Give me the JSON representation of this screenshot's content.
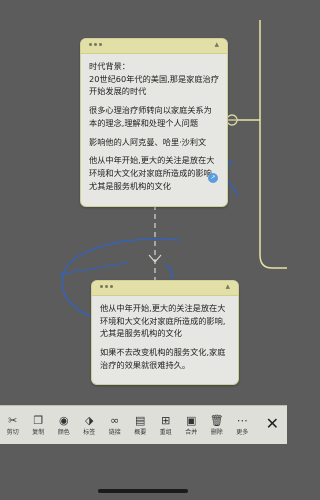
{
  "card_top": {
    "paragraphs": [
      "时代背景：\n20世纪60年代的美国,那是家庭治疗开始发展的时代",
      "很多心理治疗师转向以家庭关系为本的理念,理解和处理个人问题",
      "影响他的人阿克曼、哈里·沙利文",
      "他从中年开始,更大的关注是放在大环境和大文化对家庭所造成的影响,尤其是服务机构的文化"
    ]
  },
  "card_bottom": {
    "paragraphs": [
      "他从中年开始,更大的关注是放在大环境和大文化对家庭所造成的影响,尤其是服务机构的文化",
      "如果不去改变机构的服务文化,家庭治疗的效果就很难持久。"
    ]
  },
  "toolbar": {
    "items": [
      {
        "icon": "scissors-icon",
        "glyph": "✂",
        "label": "剪切"
      },
      {
        "icon": "copy-icon",
        "glyph": "❐",
        "label": "复制"
      },
      {
        "icon": "palette-icon",
        "glyph": "◉",
        "label": "颜色"
      },
      {
        "icon": "tag-icon",
        "glyph": "⬗",
        "label": "标签"
      },
      {
        "icon": "link-icon",
        "glyph": "∞",
        "label": "链接"
      },
      {
        "icon": "summary-icon",
        "glyph": "▤",
        "label": "概要"
      },
      {
        "icon": "layout-icon",
        "glyph": "⊞",
        "label": "重组"
      },
      {
        "icon": "merge-icon",
        "glyph": "▣",
        "label": "合并"
      },
      {
        "icon": "trash-icon",
        "glyph": "🗑",
        "label": "删除"
      },
      {
        "icon": "more-icon",
        "glyph": "⋯",
        "label": "更多"
      }
    ],
    "close_glyph": "✕"
  },
  "colors": {
    "canvas": "#5c5c5c",
    "card": "#e6e6e2",
    "card_header": "#e2e0a6",
    "connector": "#e7e3a8",
    "ink": "#2f63c6"
  }
}
